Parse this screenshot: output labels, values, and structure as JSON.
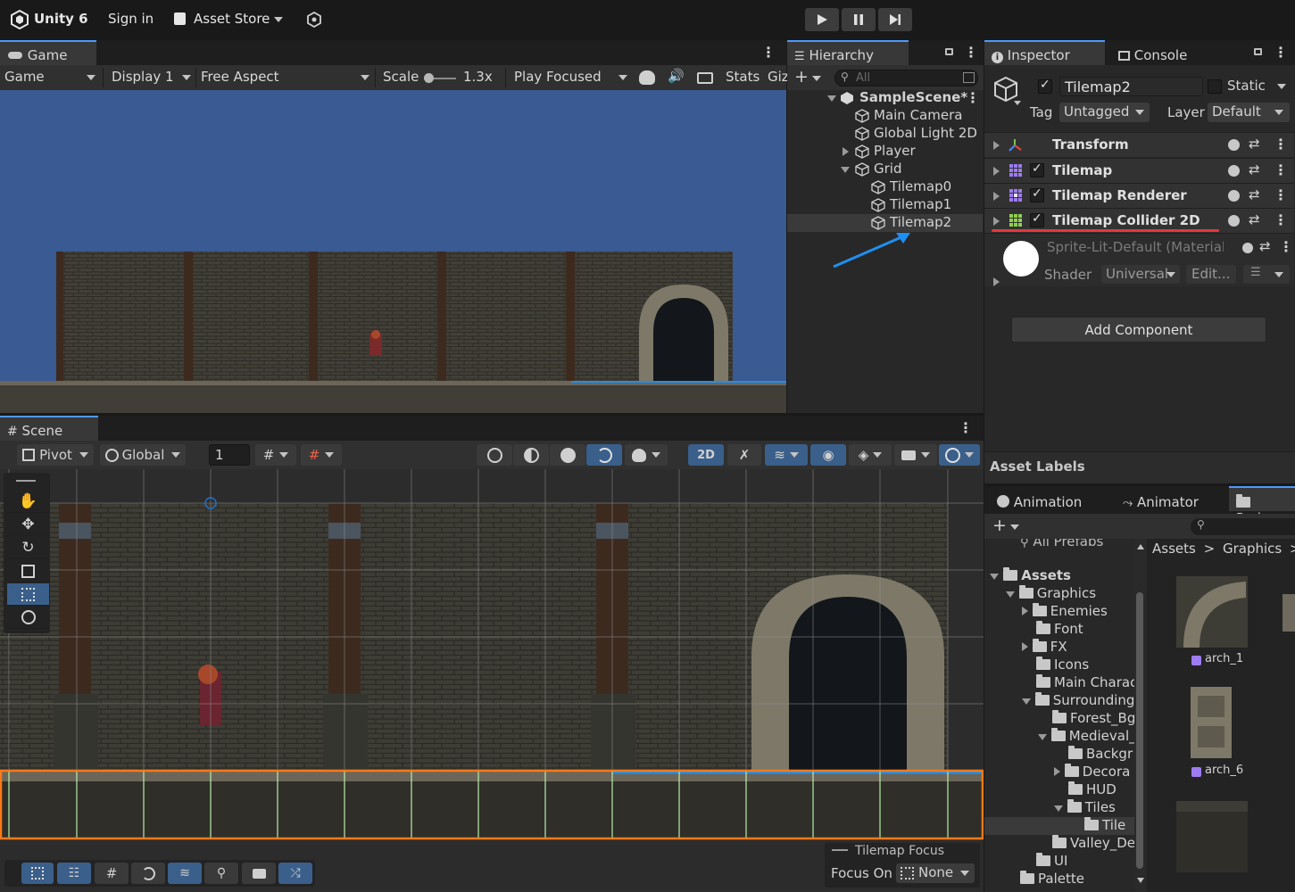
{
  "topbar": {
    "app_title": "Unity 6",
    "sign_in": "Sign in",
    "asset_store": "Asset Store"
  },
  "game": {
    "tab": "Game",
    "mode": "Game",
    "display": "Display 1",
    "aspect": "Free Aspect",
    "scale_label": "Scale",
    "scale_value": "1.3x",
    "play_focused": "Play Focused",
    "stats": "Stats",
    "gizmos": "Giz"
  },
  "hierarchy": {
    "tab": "Hierarchy",
    "search_placeholder": "All",
    "scene": "SampleScene*",
    "items": [
      "Main Camera",
      "Global Light 2D",
      "Player",
      "Grid",
      "Tilemap0",
      "Tilemap1",
      "Tilemap2"
    ]
  },
  "inspector": {
    "tab": "Inspector",
    "console_tab": "Console",
    "object_name": "Tilemap2",
    "static_label": "Static",
    "tag_label": "Tag",
    "tag_value": "Untagged",
    "layer_label": "Layer",
    "layer_value": "Default",
    "components": [
      "Transform",
      "Tilemap",
      "Tilemap Renderer",
      "Tilemap Collider 2D"
    ],
    "material_name": "Sprite-Lit-Default (Material)",
    "shader_label": "Shader",
    "shader_value": "Universal",
    "edit_label": "Edit...",
    "add_component": "Add Component",
    "asset_labels": "Asset Labels"
  },
  "scene": {
    "tab": "Scene",
    "pivot": "Pivot",
    "global": "Global",
    "grid_value": "1",
    "mode_2d": "2D",
    "tilemap_focus_title": "Tilemap Focus",
    "focus_on_label": "Focus On",
    "focus_on_value": "None"
  },
  "project": {
    "tabs": [
      "Animation",
      "Animator",
      "Projec"
    ],
    "all_prefabs": "All Prefabs",
    "breadcrumb": [
      "Assets",
      "Graphics"
    ],
    "tree": [
      "Assets",
      "Graphics",
      "Enemies",
      "Font",
      "FX",
      "Icons",
      "Main Charac",
      "Surrounding",
      "Forest_Bg",
      "Medieval_",
      "Backgr",
      "Decora",
      "HUD",
      "Tiles",
      "Tile",
      "Valley_De",
      "UI",
      "Palette"
    ],
    "assets": [
      "arch_1",
      "arch_6"
    ]
  },
  "colors": {
    "accent": "#4c9aff",
    "selection_orange": "#ff7a1a",
    "annotation_red": "#e8363d",
    "annotation_blue": "#1e8ff0",
    "sky": "#3a5a93",
    "wall": "#3f3f37"
  }
}
